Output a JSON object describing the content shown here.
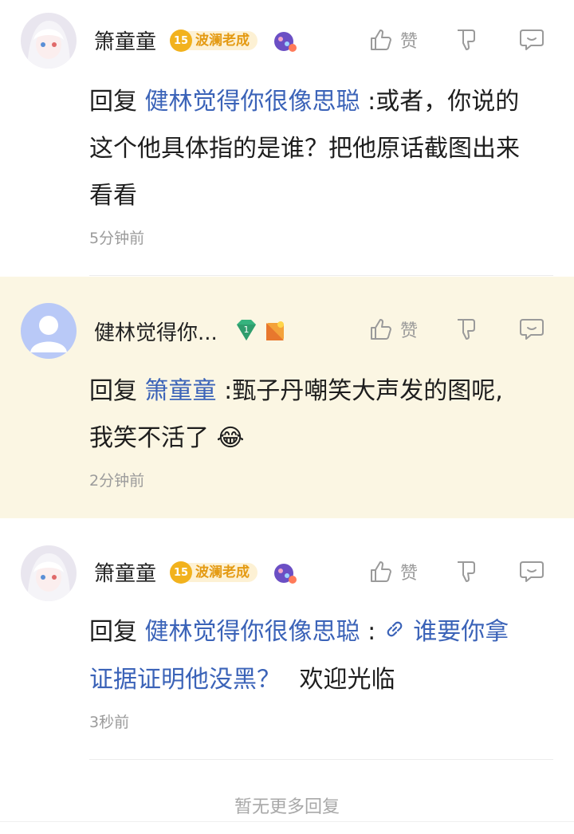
{
  "comments": [
    {
      "user": "箫童童",
      "level": "15",
      "level_title": "波澜老成",
      "like_label": "赞",
      "reply_prefix": "回复",
      "mention": "健林觉得你很像思聪",
      "line1": ":或者，你说的",
      "line2": "这个他具体指的是谁？把他原话截图出来",
      "line3": "看看",
      "time": "5分钟前"
    },
    {
      "user": "健林觉得你...",
      "level": "1",
      "like_label": "赞",
      "reply_prefix": "回复",
      "mention": "箫童童",
      "line1": ":甄子丹嘲笑大声发的图呢,",
      "line2": "我笑不活了",
      "emoji": "😂",
      "time": "2分钟前"
    },
    {
      "user": "箫童童",
      "level": "15",
      "level_title": "波澜老成",
      "like_label": "赞",
      "reply_prefix": "回复",
      "mention": "健林觉得你很像思聪",
      "colon": ":",
      "link_text_1": "谁要你拿",
      "link_text_2": "证据证明他没黑？",
      "line2_tail": "欢迎光临",
      "time": "3秒前"
    }
  ],
  "footer": "暂无更多回复",
  "colors": {
    "mention": "#3b63b8",
    "highlight_bg": "#fbf6e3",
    "badge": "#f2b21d",
    "gem": "#36b37e"
  }
}
